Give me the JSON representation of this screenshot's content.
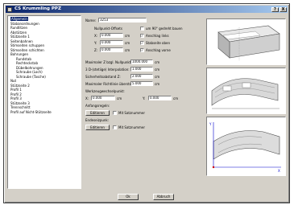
{
  "window": {
    "title": "CS Krummling PPZ",
    "help_label": "?",
    "close_label": "X"
  },
  "tree": {
    "items": [
      {
        "label": "Allgemein"
      },
      {
        "label": "Stabanordnungen"
      },
      {
        "label": "Rundlitzen"
      },
      {
        "label": "Abstützen"
      },
      {
        "label": "Stützseite 1"
      },
      {
        "label": "Seitenbahnen"
      },
      {
        "label": "Stimseiten schuppen"
      },
      {
        "label": "Stimseiten schichten"
      },
      {
        "label": "Bohrungen"
      },
      {
        "label": "Rundstab"
      },
      {
        "label": "Rechteckstab"
      },
      {
        "label": "Dübelbohrungen"
      },
      {
        "label": "Schraube (Loch)"
      },
      {
        "label": "Schraube (Tasche)"
      },
      {
        "label": "Nut"
      },
      {
        "label": "Stützseite 2"
      },
      {
        "label": "Profil 1"
      },
      {
        "label": "Profil 2"
      },
      {
        "label": "Profil 3"
      },
      {
        "label": "Stützseite 3"
      },
      {
        "label": "Trennschnitt"
      },
      {
        "label": "Profil auf Nicht-Stützseite"
      }
    ]
  },
  "form": {
    "name_label": "Name:",
    "name_value": "3253",
    "nullpunkt_label": "Nullpunkt-Offsets",
    "x_label": "X:",
    "x_value": "0.000",
    "y_label": "Y:",
    "y_value": "0.000",
    "z_label": "Z:",
    "z_value": "0.000",
    "unit": "cm",
    "gedreht_label": "um 90° gedreht bauen",
    "links_label": "Anschlag links",
    "oben_label": "Stabseite oben",
    "vorne_label": "Anschlag vorne",
    "max_label": "Maximaler Z bzgl. Nullpunkt:",
    "max_value": "1000.000",
    "interp_label": "3 D-(stetiige) Interpolation:",
    "interp_value": "1.000",
    "sicherheit_label": "Sicherheitsabstand Z:",
    "sicherheit_value": "2.000",
    "maxrichtung_label": "Maximaler Richtlinie überstell:",
    "maxrichtung_value": "5.000",
    "werkzeug_label": "Werkzeugwechselpunkt:",
    "wx_label": "X:",
    "wx_value": "0.000",
    "wy_label": "Y:",
    "wy_value": "0.000",
    "anfang_label": "Anfangsregeln:",
    "anfang_btn": "Editieren",
    "anfang_mit": "Mit Satznummer",
    "ende_label": "Endeseizpunk:",
    "ende_btn": "Editieren",
    "ende_mit": "Mit Satznummer"
  },
  "buttons": {
    "ok": "Ok",
    "cancel": "Abbruch"
  },
  "checks": {
    "gedreht": "",
    "links": "✓",
    "oben": "✓",
    "vorne": "✓",
    "anfang_mit": "",
    "ende_mit": ""
  },
  "preview": {
    "y_axis": "Y",
    "x_axis": "X"
  }
}
